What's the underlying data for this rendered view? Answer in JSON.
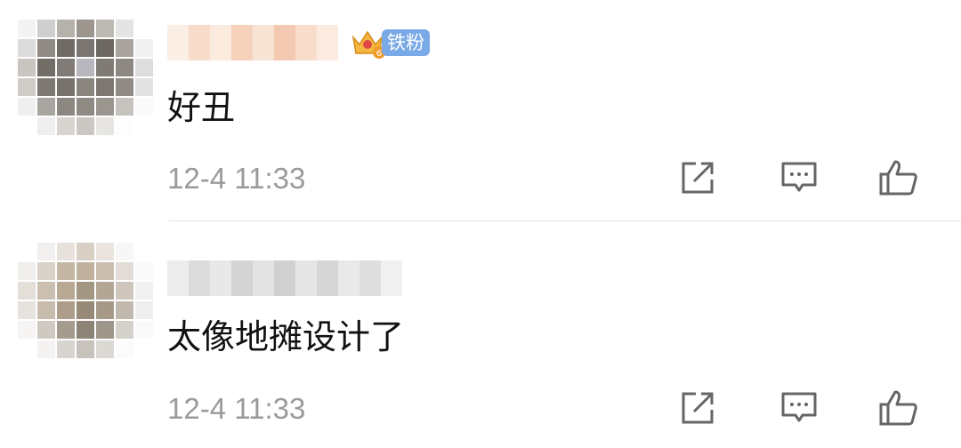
{
  "comments": [
    {
      "fan_badge": "铁粉",
      "fan_level": "6",
      "text": "好丑",
      "time": "12-4 11:33"
    },
    {
      "text": "太像地摊设计了",
      "time": "12-4 11:33"
    }
  ],
  "icons": {
    "share": "share-icon",
    "reply": "comment-icon",
    "like": "thumbs-up-icon"
  }
}
